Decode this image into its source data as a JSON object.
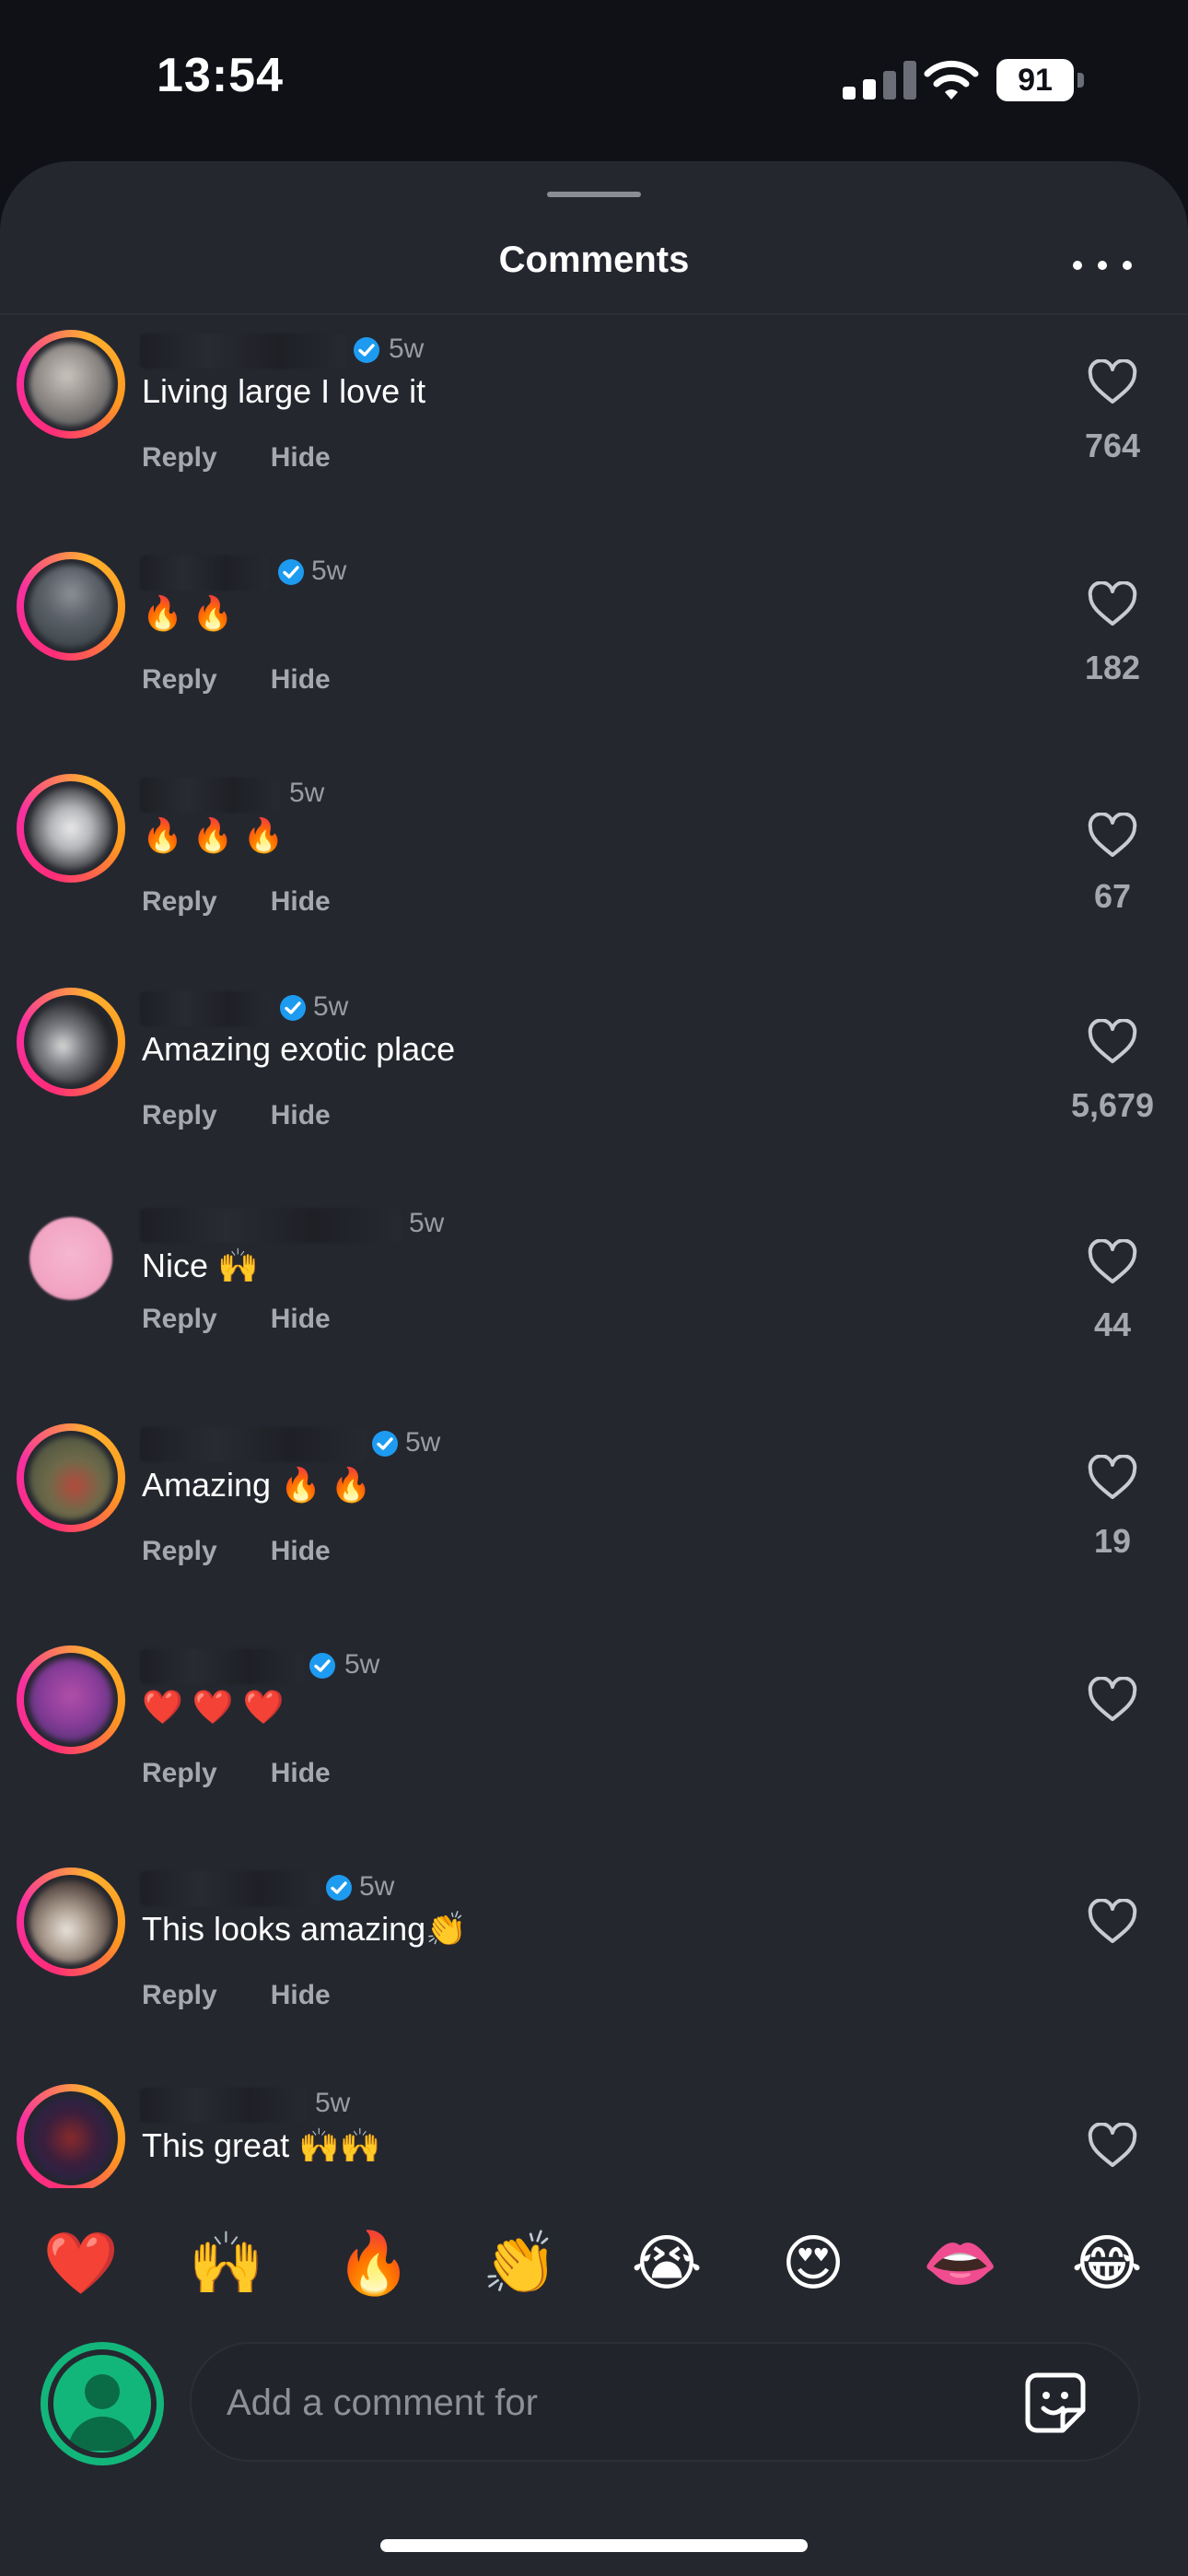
{
  "status_bar": {
    "time": "13:54",
    "battery": "91"
  },
  "sheet": {
    "title": "Comments"
  },
  "comments": [
    {
      "text": "Living large I love it",
      "age": "5w",
      "likes": "764",
      "verified": true
    },
    {
      "text": "🔥 🔥",
      "age": "5w",
      "likes": "182",
      "verified": true
    },
    {
      "text": "🔥 🔥 🔥",
      "age": "5w",
      "likes": "67",
      "verified": false
    },
    {
      "text": "Amazing exotic place",
      "age": "5w",
      "likes": "5,679",
      "verified": true
    },
    {
      "text": "Nice 🙌",
      "age": "5w",
      "likes": "44",
      "verified": false
    },
    {
      "text": "Amazing 🔥 🔥",
      "age": "5w",
      "likes": "19",
      "verified": true
    },
    {
      "text": "❤️ ❤️ ❤️",
      "age": "5w",
      "likes": "",
      "verified": true
    },
    {
      "text": "This looks amazing👏",
      "age": "5w",
      "likes": "",
      "verified": true
    },
    {
      "text": "This great 🙌🙌",
      "age": "5w",
      "likes": "",
      "verified": false
    }
  ],
  "actions": {
    "reply": "Reply",
    "hide": "Hide"
  },
  "quick_reactions": [
    "❤️",
    "🙌",
    "🔥",
    "👏",
    "😭",
    "😍",
    "👄",
    "😂"
  ],
  "composer": {
    "placeholder": "Add a comment for"
  },
  "icons": [
    "signal-icon",
    "wifi-icon",
    "battery-icon",
    "more-icon",
    "verified-badge-icon",
    "heart-icon",
    "sticker-icon",
    "profile-avatar-icon"
  ],
  "colors": {
    "background": "#25272f",
    "verified": "#1d9bf0",
    "avatar_ring": "#ff2d7a",
    "composer_avatar": "#13b67a"
  }
}
